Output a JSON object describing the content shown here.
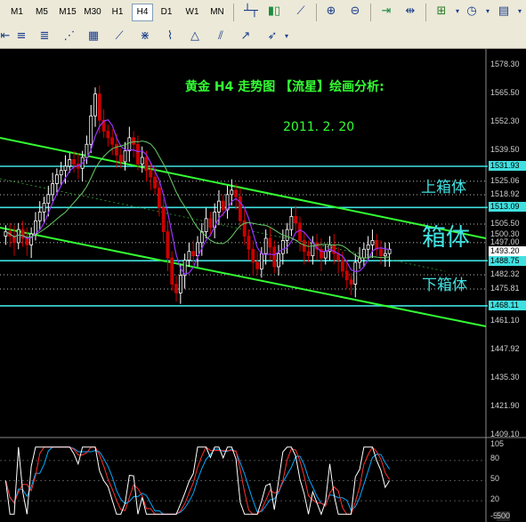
{
  "toolbar": {
    "timeframes": [
      "M1",
      "M5",
      "M15",
      "M30",
      "H1",
      "H4",
      "D1",
      "W1",
      "MN"
    ],
    "active_timeframe": "H4"
  },
  "chart": {
    "title": "黄金  H4  走势图  【流星】绘画分析:",
    "date": "2011. 2. 20",
    "upper_box_label": "上箱体",
    "box_label": "箱体",
    "lower_box_label": "下箱体",
    "price_scale": [
      "1578.30",
      "1565.50",
      "1552.30",
      "1539.50",
      "1525.06",
      "1518.92",
      "1505.50",
      "1500.30",
      "1497.00",
      "1482.32",
      "1475.81",
      "1461.10",
      "1447.92",
      "1435.30",
      "1421.90",
      "1409.10"
    ],
    "highlight_levels": {
      "upper_box": "1531.93",
      "mid_box": "1513.09",
      "current_bid": "1493.20",
      "current_ask": "1488.75",
      "lower_box": "1468.11"
    }
  },
  "indicator": {
    "scale": [
      "105",
      "80",
      "50",
      "20",
      "-5"
    ],
    "corner_value": "500"
  },
  "colors": {
    "background": "#000000",
    "cyan_level": "#40e0e0",
    "trend_green": "#33ff33",
    "candle_up": "#ffffff",
    "candle_down": "#cc0000",
    "ma_purple": "#9933ff",
    "ma_green": "#66cc66"
  },
  "chart_data": {
    "type": "candlestick",
    "title": "黄金  H4  走势图  【流星】绘画分析:",
    "ylim": [
      1409.1,
      1578.3
    ],
    "closes": [
      1502,
      1500,
      1497,
      1503,
      1499,
      1496,
      1501,
      1507,
      1511,
      1515,
      1519,
      1524,
      1528,
      1530,
      1532,
      1535,
      1533,
      1531,
      1536,
      1542,
      1555,
      1565,
      1553,
      1548,
      1545,
      1542,
      1537,
      1534,
      1539,
      1545,
      1542,
      1533,
      1536,
      1530,
      1527,
      1522,
      1513,
      1502,
      1490,
      1478,
      1474,
      1482,
      1489,
      1493,
      1491,
      1497,
      1502,
      1508,
      1504,
      1511,
      1516,
      1512,
      1519,
      1521,
      1518,
      1507,
      1500,
      1494,
      1488,
      1485,
      1492,
      1499,
      1495,
      1486,
      1492,
      1498,
      1503,
      1509,
      1506,
      1498,
      1493,
      1491,
      1497,
      1494,
      1490,
      1493,
      1496,
      1492,
      1489,
      1484,
      1480,
      1478,
      1488,
      1490,
      1494,
      1496,
      1498,
      1494,
      1491,
      1492,
      1494
    ]
  }
}
